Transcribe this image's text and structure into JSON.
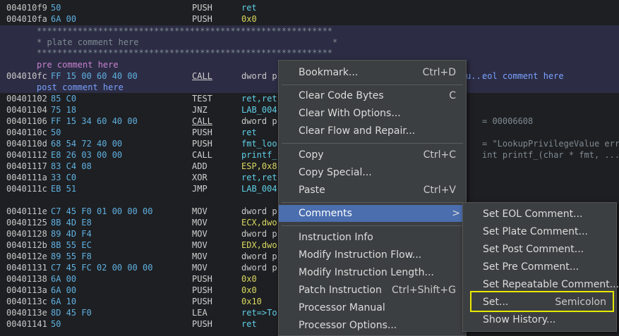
{
  "listing": {
    "rows": [
      {
        "addr": "004010f9",
        "bytes": "50",
        "mnem": "PUSH",
        "ops": "ret",
        "opsColor": "cy"
      },
      {
        "addr": "004010fa",
        "bytes": "6A 00",
        "mnem": "PUSH",
        "ops": "0x0",
        "opsColor": "yl"
      }
    ],
    "plate_lines": [
      "**********************************************************",
      "* plate comment here                                      *",
      "**********************************************************"
    ],
    "pre_comment": "pre comment here",
    "call_row": {
      "addr": "004010fc",
      "bytes": "FF 15 00 60 40 00",
      "mnem": "CALL",
      "ops": "dword p",
      "eol_prefix": "u...",
      "eol": "eol comment here"
    },
    "post_comment": "post comment here",
    "rows2": [
      {
        "addr": "00401102",
        "bytes": "85 C0",
        "mnem": "TEST",
        "ops": "ret,ret",
        "opsColor": "cy",
        "u": false
      },
      {
        "addr": "00401104",
        "bytes": "75 18",
        "mnem": "JNZ",
        "ops": "LAB_004",
        "opsColor": "cy",
        "u": false
      },
      {
        "addr": "00401106",
        "bytes": "FF 15 34 60 40 00",
        "mnem": "CALL",
        "ops": "dword p",
        "opsColor": "gy",
        "u": true,
        "rhs": "= 00006608"
      },
      {
        "addr": "0040110c",
        "bytes": "50",
        "mnem": "PUSH",
        "ops": "ret",
        "opsColor": "cy",
        "u": false
      },
      {
        "addr": "0040110d",
        "bytes": "68 54 72 40 00",
        "mnem": "PUSH",
        "ops": "fmt_loo",
        "opsColor": "cy",
        "u": false,
        "rhs": "= \"LookupPrivilegeValue erro"
      },
      {
        "addr": "00401112",
        "bytes": "E8 26 03 00 00",
        "mnem": "CALL",
        "ops": "printf_",
        "opsColor": "cy",
        "u": false,
        "rhs": "int printf_(char * fmt, ...)"
      },
      {
        "addr": "00401117",
        "bytes": "83 C4 08",
        "mnem": "ADD",
        "ops": "ESP,0x8",
        "opsColor": "yl",
        "u": false
      },
      {
        "addr": "0040111a",
        "bytes": "33 C0",
        "mnem": "XOR",
        "ops": "ret,ret",
        "opsColor": "cy",
        "u": false
      },
      {
        "addr": "0040111c",
        "bytes": "EB 51",
        "mnem": "JMP",
        "ops": "LAB_004",
        "opsColor": "cy",
        "u": false
      }
    ],
    "rows3": [
      {
        "addr": "0040111e",
        "bytes": "C7 45 F0 01 00 00 00",
        "mnem": "MOV",
        "ops": "dword p",
        "opsColor": "gy"
      },
      {
        "addr": "00401125",
        "bytes": "8B 4D E8",
        "mnem": "MOV",
        "ops": "ECX,dwo",
        "opsColor": "yl"
      },
      {
        "addr": "00401128",
        "bytes": "89 4D F4",
        "mnem": "MOV",
        "ops": "dword p",
        "opsColor": "gy"
      },
      {
        "addr": "0040112b",
        "bytes": "8B 55 EC",
        "mnem": "MOV",
        "ops": "EDX,dwo",
        "opsColor": "yl"
      },
      {
        "addr": "0040112e",
        "bytes": "89 55 F8",
        "mnem": "MOV",
        "ops": "dword p",
        "opsColor": "gy"
      },
      {
        "addr": "00401131",
        "bytes": "C7 45 FC 02 00 00 00",
        "mnem": "MOV",
        "ops": "dword p",
        "opsColor": "gy"
      },
      {
        "addr": "00401138",
        "bytes": "6A 00",
        "mnem": "PUSH",
        "ops": "0x0",
        "opsColor": "yl"
      },
      {
        "addr": "0040113a",
        "bytes": "6A 00",
        "mnem": "PUSH",
        "ops": "0x0",
        "opsColor": "yl"
      },
      {
        "addr": "0040113c",
        "bytes": "6A 10",
        "mnem": "PUSH",
        "ops": "0x10",
        "opsColor": "yl"
      },
      {
        "addr": "0040113e",
        "bytes": "8D 45 F0",
        "mnem": "LEA",
        "ops": "ret=>To",
        "opsColor": "cy"
      },
      {
        "addr": "00401141",
        "bytes": "50",
        "mnem": "PUSH",
        "ops": "ret",
        "opsColor": "cy"
      }
    ]
  },
  "context_menu": {
    "bookmark": {
      "label": "Bookmark...",
      "shortcut": "Ctrl+D"
    },
    "clear_code_bytes": {
      "label": "Clear Code Bytes",
      "shortcut": "C"
    },
    "clear_with_options": {
      "label": "Clear With Options..."
    },
    "clear_flow_repair": {
      "label": "Clear Flow and Repair..."
    },
    "copy": {
      "label": "Copy",
      "shortcut": "Ctrl+C"
    },
    "copy_special": {
      "label": "Copy Special..."
    },
    "paste": {
      "label": "Paste",
      "shortcut": "Ctrl+V"
    },
    "comments": {
      "label": "Comments",
      "arrow": ">"
    },
    "instruction_info": {
      "label": "Instruction Info"
    },
    "modify_flow": {
      "label": "Modify Instruction Flow..."
    },
    "modify_length": {
      "label": "Modify Instruction Length..."
    },
    "patch_instruction": {
      "label": "Patch Instruction",
      "shortcut": "Ctrl+Shift+G"
    },
    "processor_manual": {
      "label": "Processor Manual"
    },
    "processor_options": {
      "label": "Processor Options..."
    }
  },
  "submenu": {
    "set_eol": {
      "label": "Set EOL Comment..."
    },
    "set_plate": {
      "label": "Set Plate Comment..."
    },
    "set_post": {
      "label": "Set Post Comment..."
    },
    "set_pre": {
      "label": "Set Pre Comment..."
    },
    "set_repeatable": {
      "label": "Set Repeatable Comment..."
    },
    "set": {
      "label": "Set...",
      "shortcut": "Semicolon"
    },
    "show_history": {
      "label": "Show History..."
    }
  },
  "colors": {
    "highlight": "#4b6eaf",
    "focus": "#e8e800",
    "band": "#2c2d44"
  }
}
